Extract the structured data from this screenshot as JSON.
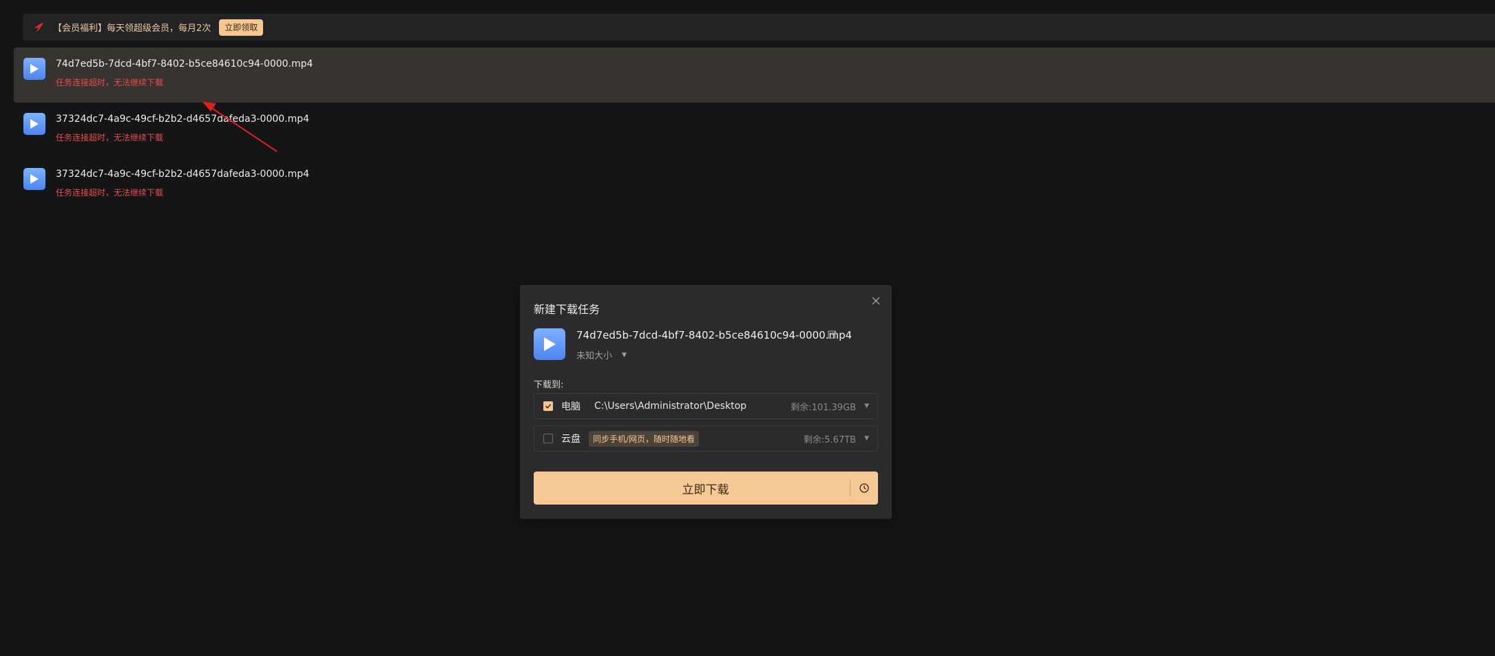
{
  "banner": {
    "text": "【会员福利】每天领超级会员，每月2次",
    "claim_label": "立即领取",
    "icon": "promo-bolt-icon"
  },
  "tasks": [
    {
      "name": "74d7ed5b-7dcd-4bf7-8402-b5ce84610c94-0000.mp4",
      "status": "任务连接超时，无法继续下载",
      "selected": true
    },
    {
      "name": "37324dc7-4a9c-49cf-b2b2-d4657dafeda3-0000.mp4",
      "status": "任务连接超时，无法继续下载",
      "selected": false
    },
    {
      "name": "37324dc7-4a9c-49cf-b2b2-d4657dafeda3-0000.mp4",
      "status": "任务连接超时，无法继续下载",
      "selected": false
    }
  ],
  "dialog": {
    "title": "新建下载任务",
    "file_name": "74d7ed5b-7dcd-4bf7-8402-b5ce84610c94-0000.mp4",
    "size_text": "未知大小",
    "save_to_label": "下载到:",
    "pc": {
      "label": "电脑",
      "path": "C:\\Users\\Administrator\\Desktop",
      "free": "剩余:101.39GB",
      "checked": true
    },
    "cloud": {
      "label": "云盘",
      "tip": "同步手机/网页，随时随地看",
      "free": "剩余:5.67TB",
      "checked": false
    },
    "download_label": "立即下载"
  },
  "colors": {
    "accent": "#f6c894",
    "error": "#e84d4d",
    "background": "#141517"
  }
}
